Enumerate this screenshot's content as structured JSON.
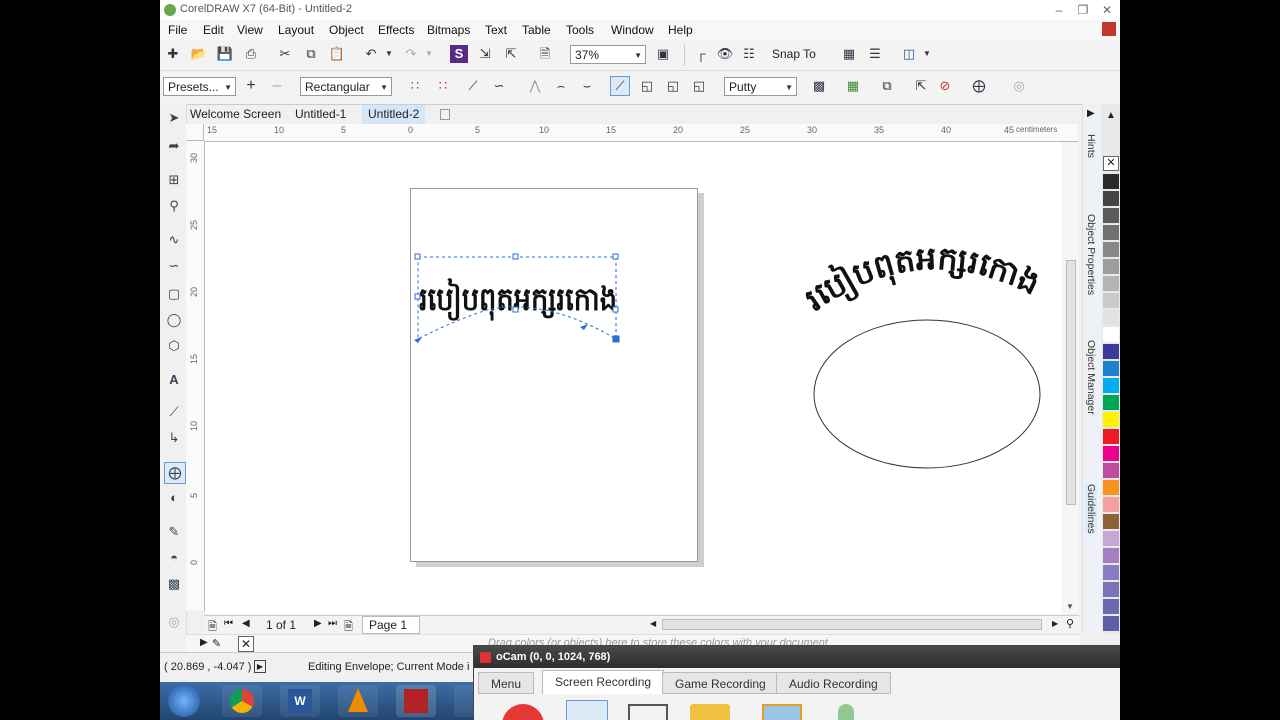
{
  "window": {
    "title": "CorelDRAW X7 (64-Bit) - Untitled-2"
  },
  "menu": [
    "File",
    "Edit",
    "View",
    "Layout",
    "Object",
    "Effects",
    "Bitmaps",
    "Text",
    "Table",
    "Tools",
    "Window",
    "Help"
  ],
  "toolbar": {
    "zoom": "37%",
    "snap_to": "Snap To"
  },
  "property_bar": {
    "presets": "Presets...",
    "mode": "Rectangular",
    "mapping": "Putty"
  },
  "tabs": [
    {
      "label": "Welcome Screen",
      "active": false
    },
    {
      "label": "Untitled-1",
      "active": false
    },
    {
      "label": "Untitled-2",
      "active": true
    }
  ],
  "ruler": {
    "h_ticks": [
      "15",
      "10",
      "5",
      "0",
      "5",
      "10",
      "15",
      "20",
      "25",
      "30",
      "35",
      "40",
      "45"
    ],
    "v_ticks": [
      "30",
      "25",
      "20",
      "15",
      "10",
      "5",
      "0"
    ],
    "units": "centimeters"
  },
  "canvas": {
    "khmer_text": "របៀបពុតអក្សរកោង"
  },
  "page_nav": {
    "count": "1 of 1",
    "page_tab": "Page 1"
  },
  "color_well_hint": "Drag colors (or objects) here to store these colors with your document",
  "status": {
    "coords": "( 20.869 , -4.047 )",
    "message": "Editing Envelope;  Current Mode i"
  },
  "dockers": [
    "Hints",
    "Object Properties",
    "Object Manager",
    "Guidelines"
  ],
  "palette": [
    "#ffffff",
    "#2b2b2b",
    "#444444",
    "#5a5a5a",
    "#707070",
    "#878787",
    "#9d9d9d",
    "#b4b4b4",
    "#cbcbcb",
    "#e2e2e2",
    "#ffffff",
    "#3a3a9a",
    "#1f7fd0",
    "#00aef0",
    "#00a651",
    "#fff200",
    "#ed1c24",
    "#ec008c",
    "#c04ba0",
    "#f7941d",
    "#f5a0a0",
    "#8c6239",
    "#c6a7d6",
    "#a57fbf",
    "#8b7bc0",
    "#7a73b5",
    "#6b6ab0",
    "#5c5fa8"
  ],
  "ocam": {
    "title": "oCam (0, 0, 1024, 768)",
    "tabs": [
      "Menu",
      "Screen Recording",
      "Game Recording",
      "Audio Recording"
    ],
    "active_tab": "Screen Recording"
  }
}
